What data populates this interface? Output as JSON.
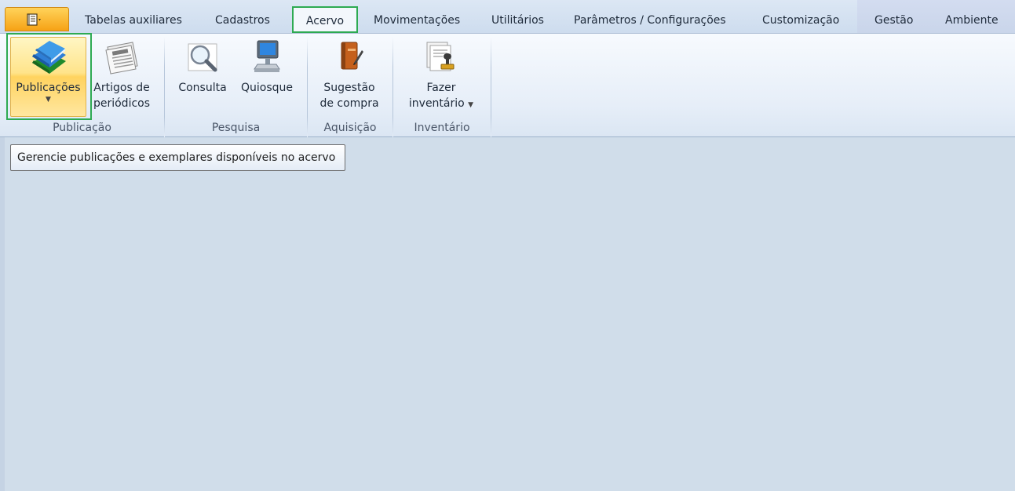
{
  "tabs": [
    {
      "label": "Tabelas auxiliares"
    },
    {
      "label": "Cadastros"
    },
    {
      "label": "Acervo",
      "active": true
    },
    {
      "label": "Movimentações"
    },
    {
      "label": "Utilitários"
    },
    {
      "label": "Parâmetros / Configurações"
    },
    {
      "label": "Customização"
    },
    {
      "label": "Gestão"
    },
    {
      "label": "Ambiente"
    }
  ],
  "ribbon": {
    "groups": [
      {
        "label": "Publicação",
        "buttons": [
          {
            "line1": "Publicações",
            "icon": "books-icon",
            "has_dropdown": true
          },
          {
            "line1": "Artigos de",
            "line2": "periódicos",
            "icon": "newspaper-icon"
          }
        ]
      },
      {
        "label": "Pesquisa",
        "buttons": [
          {
            "line1": "Consulta",
            "icon": "magnifier-icon"
          },
          {
            "line1": "Quiosque",
            "icon": "kiosk-computer-icon"
          }
        ]
      },
      {
        "label": "Aquisição",
        "buttons": [
          {
            "line1": "Sugestão",
            "line2": "de compra",
            "icon": "notebook-pen-icon"
          }
        ]
      },
      {
        "label": "Inventário",
        "buttons": [
          {
            "line1": "Fazer",
            "line2": "inventário",
            "icon": "stamp-documents-icon",
            "has_dropdown": true
          }
        ]
      }
    ]
  },
  "tooltip": {
    "text": "Gerencie publicações e exemplares disponíveis no acervo"
  },
  "colors": {
    "accent_orange": "#f6a215",
    "highlight_green": "#2eaa52",
    "workspace": "#d0ddea"
  }
}
